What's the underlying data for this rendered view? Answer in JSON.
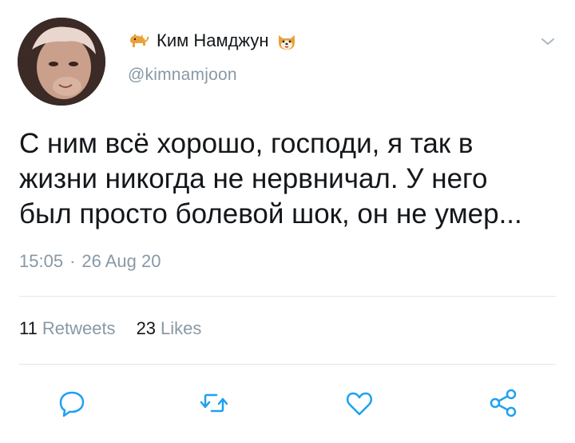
{
  "user": {
    "display_name": "Ким Намджун",
    "handle": "@kimnamjoon",
    "emoji_left": "dog-emoji",
    "emoji_right": "dog-face-emoji"
  },
  "tweet": {
    "text": "С ним всё хорошо, господи, я так в\nжизни никогда не нервничал. У него\nбыл просто болевой шок, он не умер...",
    "time": "15:05",
    "separator": "·",
    "date": "26 Aug 20"
  },
  "stats": {
    "retweets_count": "11",
    "retweets_label": "Retweets",
    "likes_count": "23",
    "likes_label": "Likes"
  },
  "actions": [
    "reply-icon",
    "retweet-icon",
    "like-icon",
    "share-icon"
  ],
  "colors": {
    "text": "#14171a",
    "secondary": "#8899a6",
    "icon": "#1da1f2",
    "divider": "#e1e8ed"
  }
}
